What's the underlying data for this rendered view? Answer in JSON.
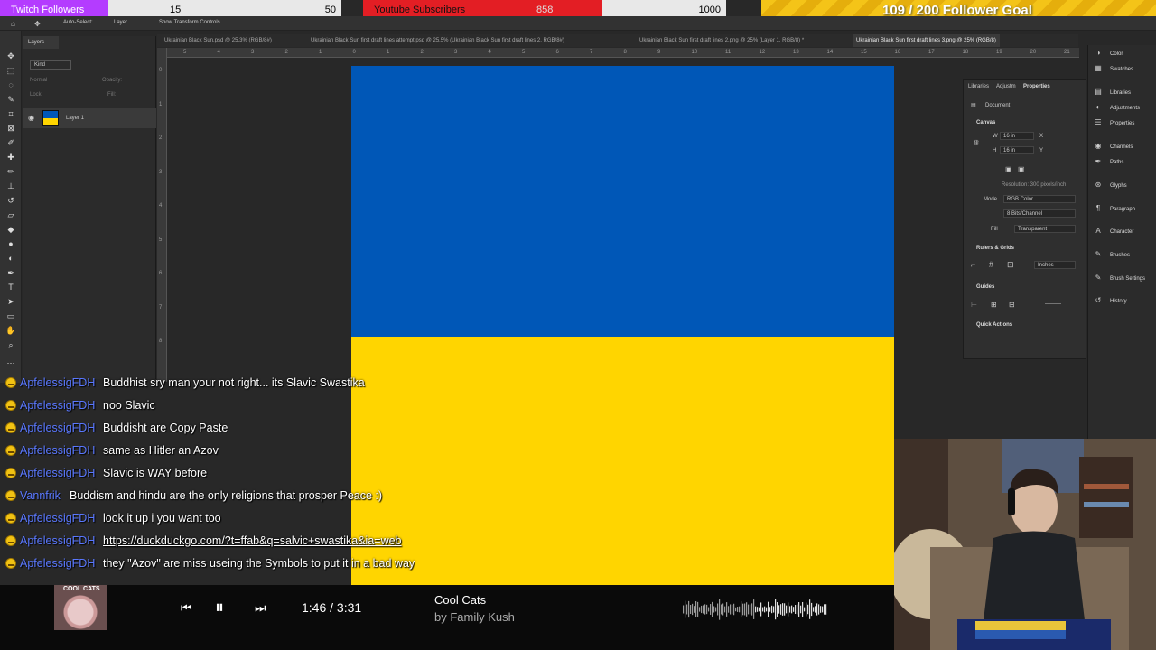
{
  "stream": {
    "twitch": {
      "label": "Twitch Followers",
      "current": "15",
      "max": "50",
      "progress": 0.3
    },
    "youtube": {
      "label": "Youtube Subscribers",
      "current": "858",
      "max": "1000",
      "progress": 0.658
    },
    "goal": {
      "text": "109 / 200 Follower Goal"
    }
  },
  "options_bar": {
    "auto_select": "Auto-Select:",
    "layer": "Layer",
    "show_transform": "Show Transform Controls"
  },
  "layers_panel": {
    "tab": "Layers",
    "filter": "Kind",
    "blend": "Normal",
    "opacity": "Opacity:",
    "lock": "Lock:",
    "fill": "Fill:",
    "layer_name": "Layer 1"
  },
  "doc_tabs": [
    "Ukrainian Black Sun.psd @ 25.3% (RGB/8#)",
    "Ukrainian Black Sun first draft lines attempt.psd @ 25.5% (Ukrainian Black Sun first draft lines 2, RGB/8#)",
    "Ukrainian Black Sun first draft lines 2.png @ 25% (Layer 1, RGB/8) *",
    "Ukrainian Black Sun first draft lines 3.png @ 25% (RGB/8)"
  ],
  "ruler_top": [
    "5",
    "4",
    "3",
    "2",
    "1",
    "0",
    "1",
    "2",
    "3",
    "4",
    "5",
    "6",
    "7",
    "8",
    "9",
    "10",
    "11",
    "12",
    "13",
    "14",
    "15",
    "16",
    "17",
    "18",
    "19",
    "20",
    "21"
  ],
  "ruler_left": [
    "0",
    "1",
    "2",
    "3",
    "4",
    "5",
    "6",
    "7",
    "8"
  ],
  "canvas": {
    "blue": "#0057b7",
    "yellow": "#ffd500"
  },
  "properties": {
    "tabs": [
      "Libraries",
      "Adjustm",
      "Properties"
    ],
    "document": "Document",
    "canvas": "Canvas",
    "w_label": "W",
    "w_value": "16 in",
    "h_label": "H",
    "h_value": "16 in",
    "x_label": "X",
    "y_label": "Y",
    "resolution": "Resolution: 300 pixels/inch",
    "mode_label": "Mode",
    "mode_value": "RGB Color",
    "bits_value": "8 Bits/Channel",
    "fill_label": "Fill",
    "fill_value": "Transparent",
    "rulers_grids": "Rulers & Grids",
    "units": "Inches",
    "guides": "Guides",
    "quick_actions": "Quick Actions"
  },
  "right_panels": [
    {
      "name": "Color",
      "icon": "color-icon"
    },
    {
      "name": "Swatches",
      "icon": "swatches-icon"
    },
    {
      "name": "Libraries",
      "icon": "libraries-icon"
    },
    {
      "name": "Adjustments",
      "icon": "adjustments-icon"
    },
    {
      "name": "Properties",
      "icon": "properties-icon"
    },
    {
      "name": "Channels",
      "icon": "channels-icon"
    },
    {
      "name": "Paths",
      "icon": "paths-icon"
    },
    {
      "name": "Glyphs",
      "icon": "glyphs-icon"
    },
    {
      "name": "Paragraph",
      "icon": "paragraph-icon"
    },
    {
      "name": "Character",
      "icon": "character-icon"
    },
    {
      "name": "Brushes",
      "icon": "brushes-icon"
    },
    {
      "name": "Brush Settings",
      "icon": "brush-settings-icon"
    },
    {
      "name": "History",
      "icon": "history-icon"
    }
  ],
  "chat": [
    {
      "user": "ApfelessigFDH",
      "msg": "Buddhist sry man your not right... its Slavic Swastika",
      "link": false
    },
    {
      "user": "ApfelessigFDH",
      "msg": "noo Slavic",
      "link": false
    },
    {
      "user": "ApfelessigFDH",
      "msg": "Buddisht are Copy Paste",
      "link": false
    },
    {
      "user": "ApfelessigFDH",
      "msg": "same as Hitler an Azov",
      "link": false
    },
    {
      "user": "ApfelessigFDH",
      "msg": "Slavic is WAY before",
      "link": false
    },
    {
      "user": "Vannfrik",
      "msg": "Buddism and hindu are the only religions that prosper Peace :)",
      "link": false
    },
    {
      "user": "ApfelessigFDH",
      "msg": "look it up i you want too",
      "link": false
    },
    {
      "user": "ApfelessigFDH",
      "msg": "https://duckduckgo.com/?t=ffab&q=salvic+swastika&ia=web",
      "link": true
    },
    {
      "user": "ApfelessigFDH",
      "msg": "they \"Azov\" are miss useing the Symbols to put it in a bad way",
      "link": false
    }
  ],
  "player": {
    "album_label": "COOL CATS",
    "time": "1:46 / 3:31",
    "title": "Cool Cats",
    "artist": "by Family Kush",
    "progress": 0.502
  }
}
